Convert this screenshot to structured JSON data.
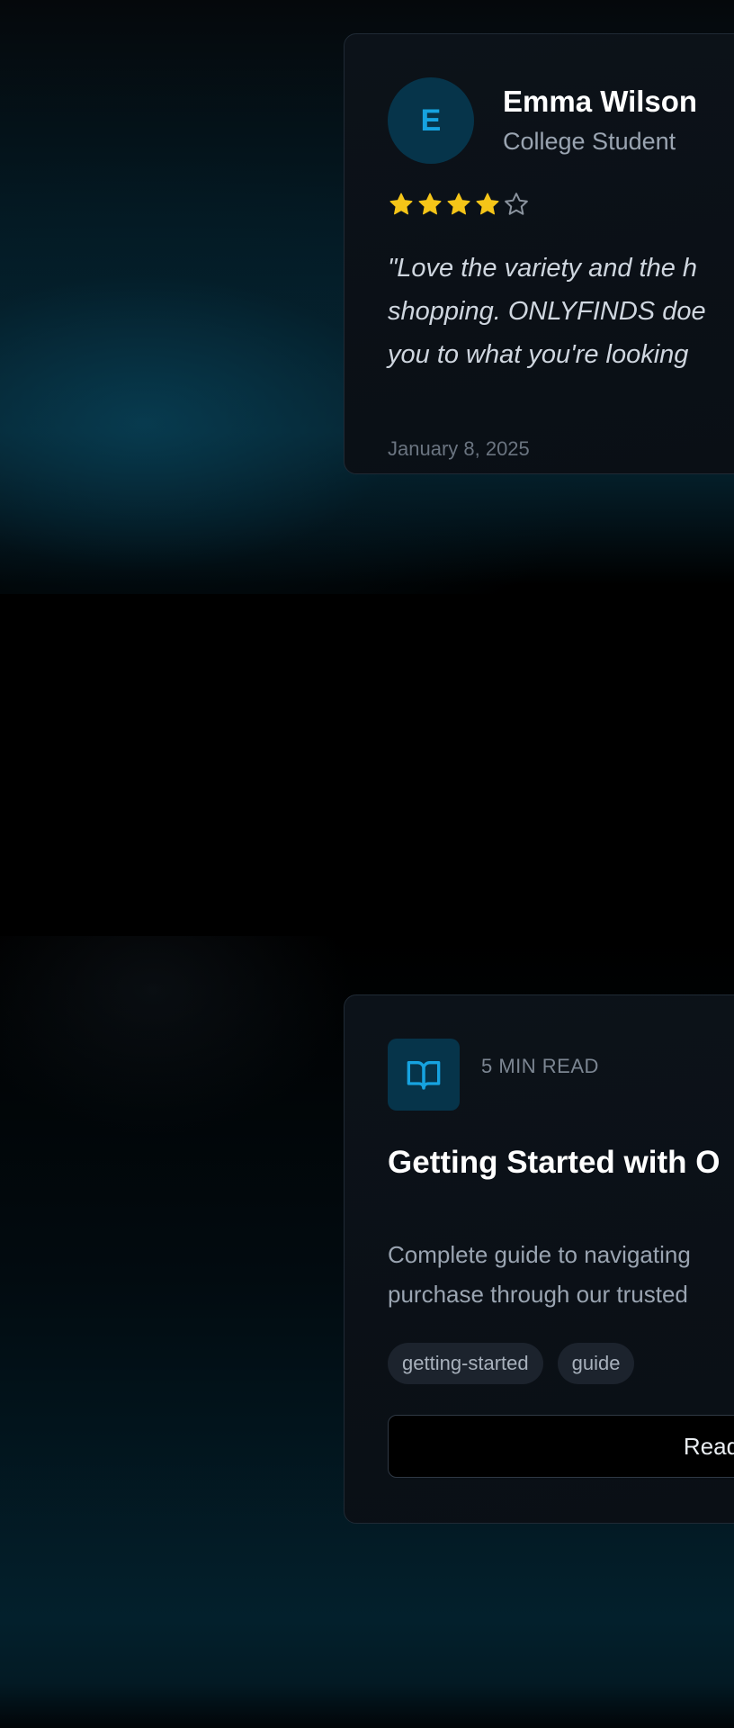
{
  "review": {
    "avatar_initial": "E",
    "name": "Emma Wilson",
    "role": "College Student",
    "rating": 4,
    "max_rating": 5,
    "quote_lines": [
      "\"Love the variety and the h",
      "shopping. ONLYFINDS doe",
      "you to what you're looking"
    ],
    "date": "January 8, 2025"
  },
  "blog": {
    "icon": "book-open-icon",
    "read_time": "5 MIN READ",
    "title": "Getting Started with O",
    "excerpt_lines": [
      "Complete guide to navigating",
      "purchase through our trusted"
    ],
    "tags": [
      "getting-started",
      "guide"
    ],
    "button_label": "Read"
  },
  "colors": {
    "accent": "#16a3e0",
    "star_filled": "#f5c518",
    "star_empty": "#8a939e",
    "card_bg": "#0b1016",
    "card_border": "#202a35"
  }
}
